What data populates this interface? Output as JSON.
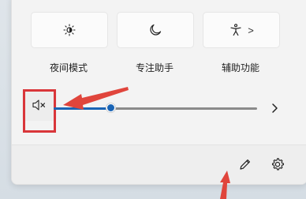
{
  "quick_settings": {
    "tiles": [
      {
        "label": "夜间模式",
        "icon": "night-light-icon"
      },
      {
        "label": "专注助手",
        "icon": "moon-icon"
      },
      {
        "label": "辅助功能",
        "icon": "accessibility-icon",
        "has_chevron": true
      }
    ],
    "chevron_glyph": ">"
  },
  "volume": {
    "icon": "speaker-muted-icon",
    "level_percent": 28,
    "chevron_icon": "chevron-right-icon"
  },
  "footer": {
    "edit_icon": "pencil-icon",
    "settings_icon": "gear-icon"
  },
  "colors": {
    "accent": "#1a64b5",
    "highlight": "#d9363a",
    "annotation_arrow": "#e0453c"
  }
}
